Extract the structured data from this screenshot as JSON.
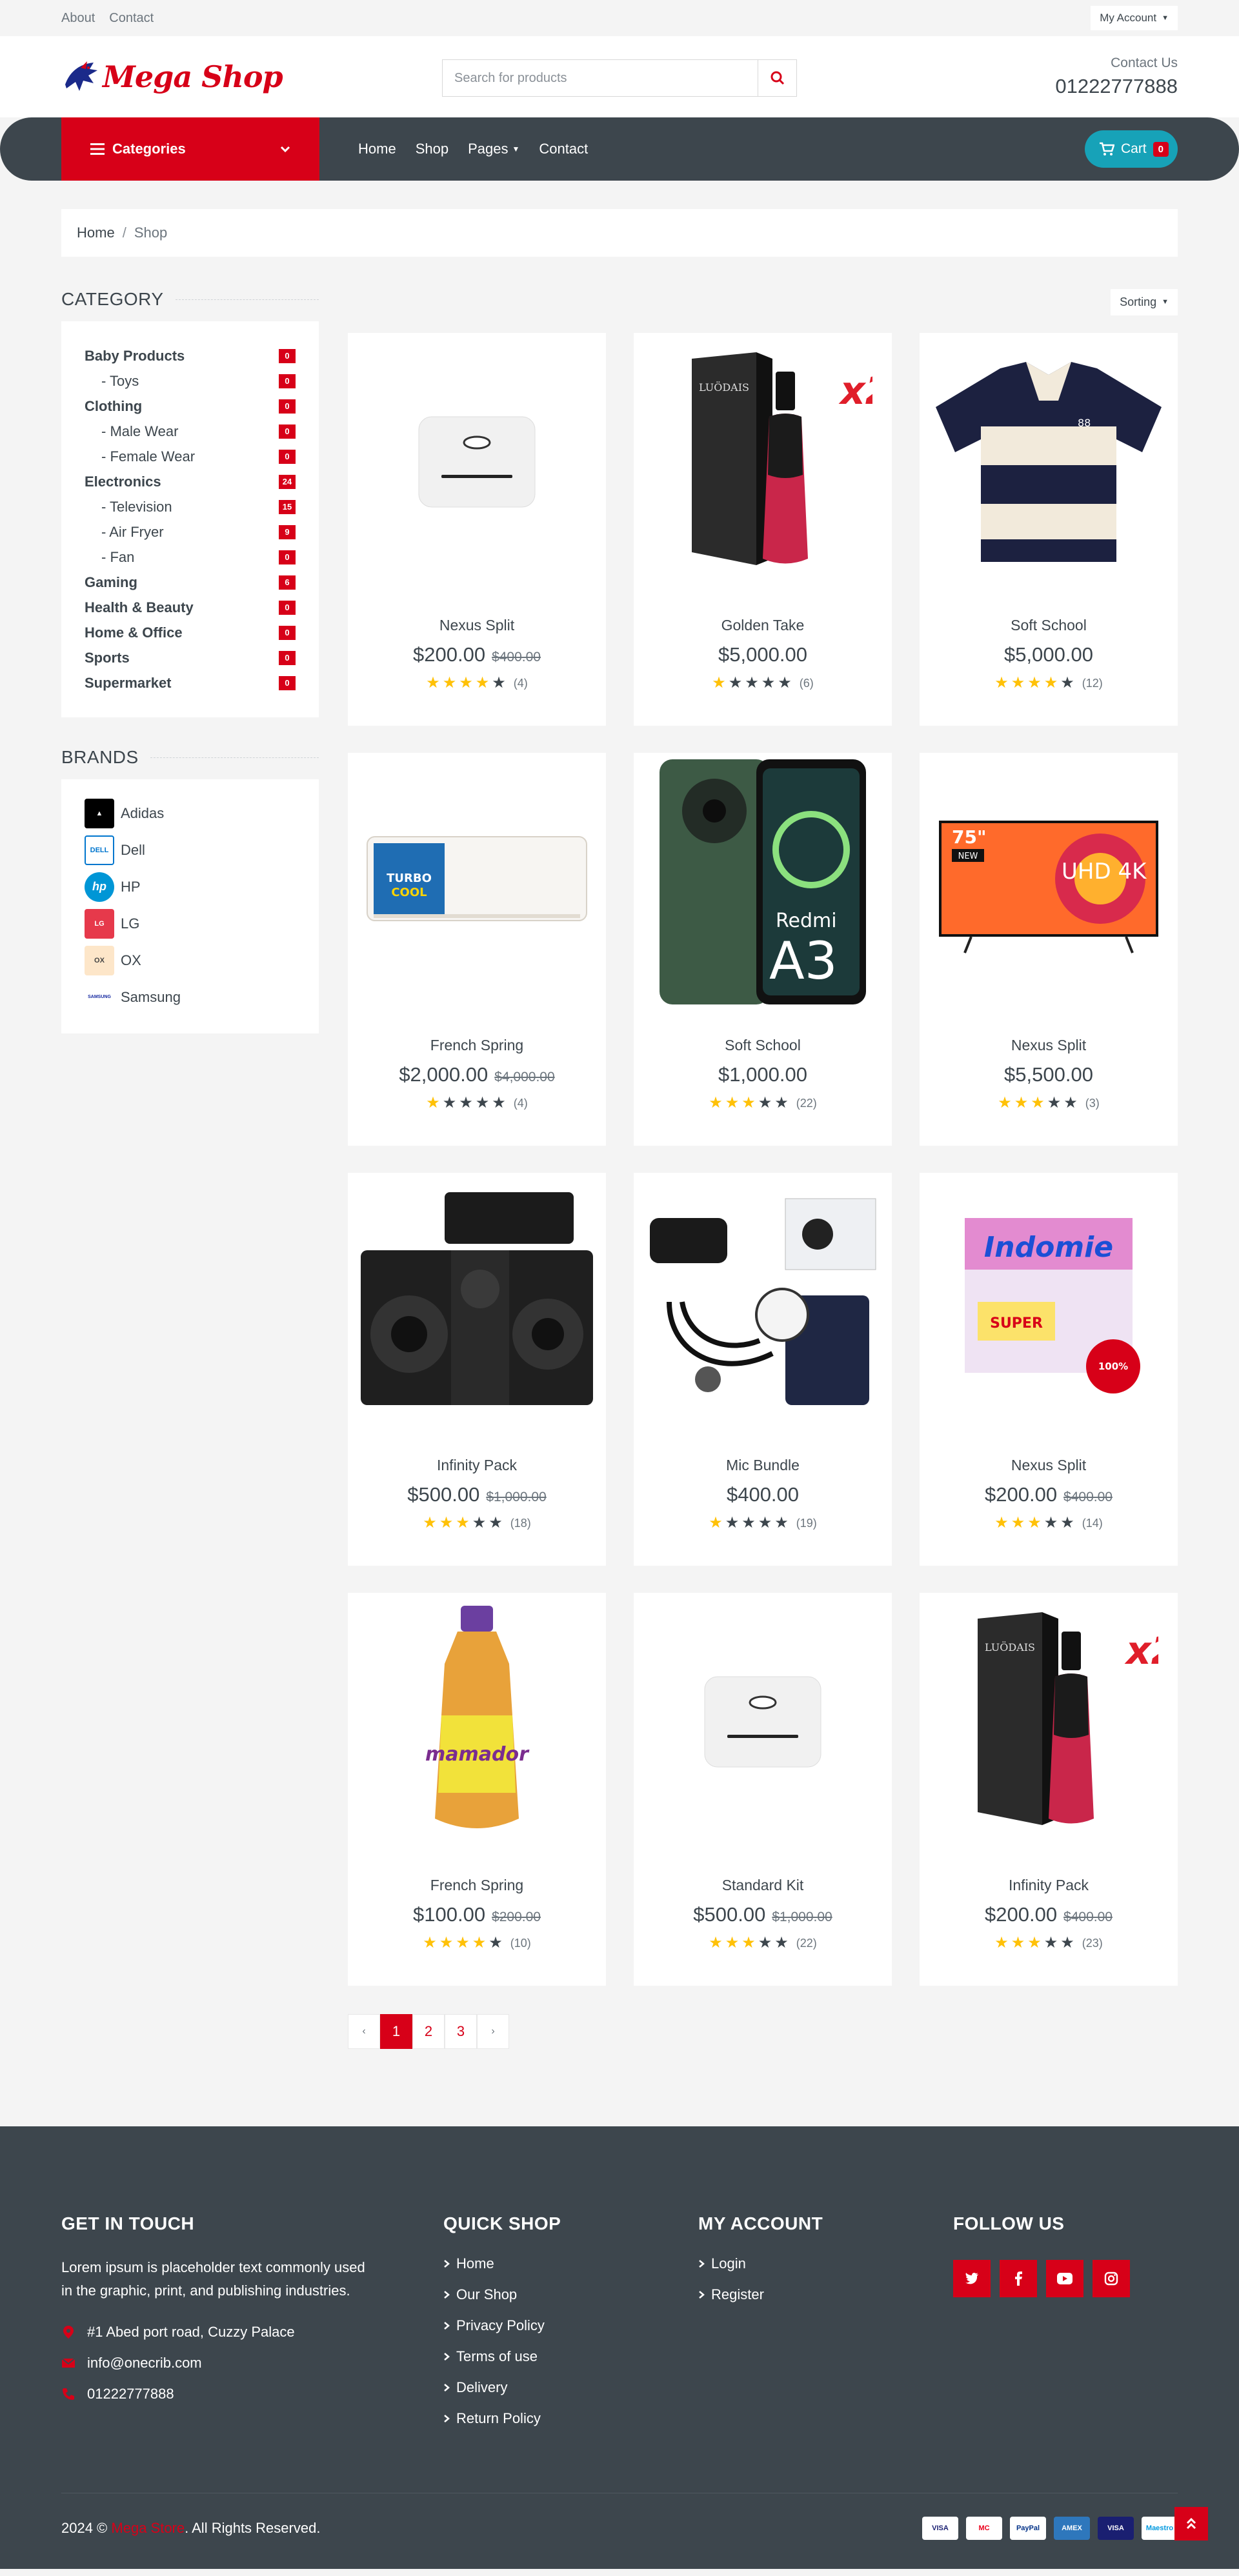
{
  "topbar": {
    "links": [
      "About",
      "Contact"
    ],
    "account": "My Account"
  },
  "header": {
    "logo_text": "Mega Shop",
    "search_placeholder": "Search for products",
    "contact_label": "Contact Us",
    "contact_phone": "01222777888"
  },
  "nav": {
    "categories_label": "Categories",
    "links": [
      "Home",
      "Shop",
      "Pages",
      "Contact"
    ],
    "cart_label": "Cart",
    "cart_count": "0"
  },
  "breadcrumb": {
    "home": "Home",
    "current": "Shop"
  },
  "sidebar": {
    "category_title": "CATEGORY",
    "categories": [
      {
        "name": "Baby Products",
        "count": "0",
        "level": "parent"
      },
      {
        "name": "- Toys",
        "count": "0",
        "level": "child"
      },
      {
        "name": "Clothing",
        "count": "0",
        "level": "parent"
      },
      {
        "name": "- Male Wear",
        "count": "0",
        "level": "child"
      },
      {
        "name": "- Female Wear",
        "count": "0",
        "level": "child"
      },
      {
        "name": "Electronics",
        "count": "24",
        "level": "parent"
      },
      {
        "name": "- Television",
        "count": "15",
        "level": "child"
      },
      {
        "name": "- Air Fryer",
        "count": "9",
        "level": "child"
      },
      {
        "name": "- Fan",
        "count": "0",
        "level": "child"
      },
      {
        "name": "Gaming",
        "count": "6",
        "level": "parent"
      },
      {
        "name": "Health & Beauty",
        "count": "0",
        "level": "parent"
      },
      {
        "name": "Home & Office",
        "count": "0",
        "level": "parent"
      },
      {
        "name": "Sports",
        "count": "0",
        "level": "parent"
      },
      {
        "name": "Supermarket",
        "count": "0",
        "level": "parent"
      }
    ],
    "brands_title": "BRANDS",
    "brands": [
      {
        "name": "Adidas",
        "icon": "adidas-logo"
      },
      {
        "name": "Dell",
        "icon": "dell-logo"
      },
      {
        "name": "HP",
        "icon": "hp-logo"
      },
      {
        "name": "LG",
        "icon": "lg-logo"
      },
      {
        "name": "OX",
        "icon": "ox-logo"
      },
      {
        "name": "Samsung",
        "icon": "samsung-logo"
      }
    ]
  },
  "sorting_label": "Sorting",
  "products": [
    {
      "name": "Nexus Split",
      "price": "$200.00",
      "old": "$400.00",
      "stars": 4,
      "reviews": "(4)",
      "image": "router"
    },
    {
      "name": "Golden Take",
      "price": "$5,000.00",
      "old": "",
      "stars": 1,
      "reviews": "(6)",
      "image": "serum"
    },
    {
      "name": "Soft School",
      "price": "$5,000.00",
      "old": "",
      "stars": 4,
      "reviews": "(12)",
      "image": "polo"
    },
    {
      "name": "French Spring",
      "price": "$2,000.00",
      "old": "$4,000.00",
      "stars": 1,
      "reviews": "(4)",
      "image": "aircon"
    },
    {
      "name": "Soft School",
      "price": "$1,000.00",
      "old": "",
      "stars": 3,
      "reviews": "(22)",
      "image": "phone"
    },
    {
      "name": "Nexus Split",
      "price": "$5,500.00",
      "old": "",
      "stars": 3,
      "reviews": "(3)",
      "image": "tv"
    },
    {
      "name": "Infinity Pack",
      "price": "$500.00",
      "old": "$1,000.00",
      "stars": 3,
      "reviews": "(18)",
      "image": "speakers"
    },
    {
      "name": "Mic Bundle",
      "price": "$400.00",
      "old": "",
      "stars": 1,
      "reviews": "(19)",
      "image": "bp-monitor"
    },
    {
      "name": "Nexus Split",
      "price": "$200.00",
      "old": "$400.00",
      "stars": 3,
      "reviews": "(14)",
      "image": "noodles"
    },
    {
      "name": "French Spring",
      "price": "$100.00",
      "old": "$200.00",
      "stars": 4,
      "reviews": "(10)",
      "image": "oil"
    },
    {
      "name": "Standard Kit",
      "price": "$500.00",
      "old": "$1,000.00",
      "stars": 3,
      "reviews": "(22)",
      "image": "router"
    },
    {
      "name": "Infinity Pack",
      "price": "$200.00",
      "old": "$400.00",
      "stars": 3,
      "reviews": "(23)",
      "image": "serum"
    }
  ],
  "pagination": {
    "prev": "‹",
    "pages": [
      "1",
      "2",
      "3"
    ],
    "next": "›",
    "active": "1"
  },
  "footer": {
    "touch_title": "GET IN TOUCH",
    "touch_text": "Lorem ipsum is placeholder text commonly used in the graphic, print, and publishing industries.",
    "address": "#1 Abed port road, Cuzzy Palace",
    "email": "info@onecrib.com",
    "phone": "01222777888",
    "quick_title": "QUICK SHOP",
    "quick_links": [
      "Home",
      "Our Shop",
      "Privacy Policy",
      "Terms of use",
      "Delivery",
      "Return Policy"
    ],
    "account_title": "MY ACCOUNT",
    "account_links": [
      "Login",
      "Register"
    ],
    "follow_title": "FOLLOW US",
    "socials": [
      "twitter-icon",
      "facebook-icon",
      "youtube-icon",
      "instagram-icon"
    ],
    "copy_year": "2024 ©",
    "copy_brand": "Mega Store",
    "copy_rest": ". All Rights Reserved.",
    "payments": [
      "VISA",
      "MC",
      "PayPal",
      "AMEX",
      "VISA",
      "Maestro"
    ]
  },
  "colors": {
    "accent": "#d70018",
    "dark": "#3d464d",
    "cart": "#17a2b8",
    "star": "#ffc107"
  }
}
